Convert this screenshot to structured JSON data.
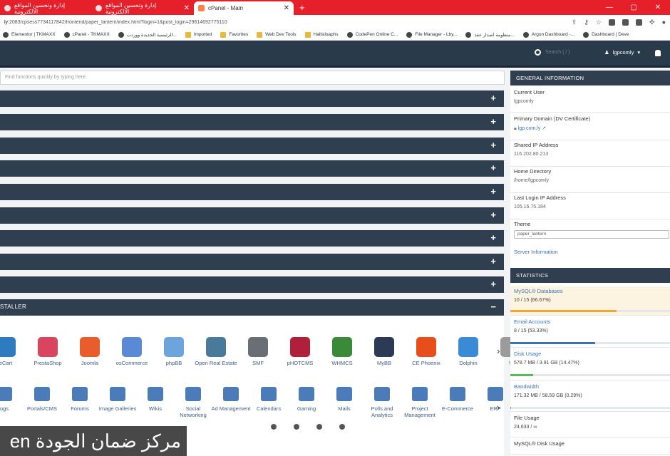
{
  "browser": {
    "tabs": [
      {
        "title": "إدارة وتحسين المواقع الالكترونية"
      },
      {
        "title": "إدارة وتحسين المواقع الالكترونية"
      },
      {
        "title": "cPanel - Main"
      }
    ],
    "new_tab": "+",
    "url_prefix": "ly",
    "url_rest": ":2083/cpsess7734117842/frontend/paper_lantern/index.html?login=1&post_login=29614692775110",
    "bookmarks": [
      {
        "label": "Elementor | TKMAXX",
        "icon": "globe-icon"
      },
      {
        "label": "cPanel - TKMAXX",
        "icon": "cpanel-icon"
      },
      {
        "label": "الرئيسية الجديدة ووردب...",
        "icon": "wordpress-icon"
      },
      {
        "label": "Imported",
        "icon": "folder-icon"
      },
      {
        "label": "Favorites",
        "icon": "folder-icon"
      },
      {
        "label": "Web Dev Tools",
        "icon": "folder-icon"
      },
      {
        "label": "Hallsiloaphs",
        "icon": "folder-icon"
      },
      {
        "label": "CodePen Online C...",
        "icon": "codepen-icon"
      },
      {
        "label": "File Manager - Lby...",
        "icon": "file-icon"
      },
      {
        "label": "منظومة اصدار عقد...",
        "icon": "globe-icon"
      },
      {
        "label": "Argon Dashboard -...",
        "icon": "globe-icon"
      },
      {
        "label": "Dashboard | Deve",
        "icon": "globe-icon"
      }
    ]
  },
  "header": {
    "search_placeholder": "Search ( / )",
    "username": "lgpcomly"
  },
  "filter": {
    "placeholder": "Find functions quickly by typing here."
  },
  "categories": [
    {
      "label": ""
    },
    {
      "label": ""
    },
    {
      "label": ""
    },
    {
      "label": ""
    },
    {
      "label": ""
    },
    {
      "label": ""
    },
    {
      "label": ""
    },
    {
      "label": ""
    },
    {
      "label": ""
    },
    {
      "label": ""
    },
    {
      "label": "STALLER",
      "expanded": true
    }
  ],
  "category_toggle": {
    "collapsed": "+",
    "expanded": "−"
  },
  "apps": [
    {
      "label": "eCart",
      "color": "#2e7bc0"
    },
    {
      "label": "PrestaShop",
      "color": "#d9455f"
    },
    {
      "label": "Joomla",
      "color": "#e95d2d"
    },
    {
      "label": "osCommerce",
      "color": "#5a8ad6"
    },
    {
      "label": "phpBB",
      "color": "#6ea4de"
    },
    {
      "label": "Open Real Estate",
      "color": "#4a7a9a"
    },
    {
      "label": "SMF",
      "color": "#6a6f75"
    },
    {
      "label": "pHOTCMS",
      "color": "#b0203a"
    },
    {
      "label": "WHMCS",
      "color": "#3a8a3a"
    },
    {
      "label": "MyBB",
      "color": "#2c3a56"
    },
    {
      "label": "CE Phoenix",
      "color": "#e84d1c"
    },
    {
      "label": "Dolphin",
      "color": "#3a8ad8"
    },
    {
      "label": "Y",
      "color": "#9b9b9b"
    }
  ],
  "app_categories": [
    {
      "label": "ogs"
    },
    {
      "label": "Portals/CMS"
    },
    {
      "label": "Forums"
    },
    {
      "label": "Image Galleries"
    },
    {
      "label": "Wikis"
    },
    {
      "label": "Social Networking"
    },
    {
      "label": "Ad Management"
    },
    {
      "label": "Calendars"
    },
    {
      "label": "Gaming"
    },
    {
      "label": "Mails"
    },
    {
      "label": "Polls and Analytics"
    },
    {
      "label": "Project Management"
    },
    {
      "label": "E-Commerce"
    },
    {
      "label": "ERP"
    }
  ],
  "carousel_next": "›",
  "overlay_text": "مركز ضمان الجودة en",
  "general_info": {
    "heading": "GENERAL INFORMATION",
    "current_user_label": "Current User",
    "current_user": "lgpcomly",
    "primary_domain_label": "Primary Domain (DV Certificate)",
    "primary_domain": "lgp.com.ly",
    "shared_ip_label": "Shared IP Address",
    "shared_ip": "116.202.80.213",
    "home_dir_label": "Home Directory",
    "home_dir": "/home/lgpcomly",
    "last_login_label": "Last Login IP Address",
    "last_login": "105.16.75.184",
    "theme_label": "Theme",
    "theme": "paper_lantern",
    "server_info": "Server Information"
  },
  "statistics": {
    "heading": "STATISTICS",
    "items": [
      {
        "label": "MySQL® Databases",
        "value": "10 / 15   (66.67%)",
        "percent": 66.67,
        "color": "#f0a63a"
      },
      {
        "label": "Email Accounts",
        "value": "8 / 15   (53.33%)",
        "percent": 53.33,
        "color": "#3a74b4"
      },
      {
        "label": "Disk Usage",
        "value": "578.7 MB / 3.91 GB   (14.47%)",
        "percent": 14.47,
        "color": "#5cb85c"
      },
      {
        "label": "Bandwidth",
        "value": "171.32 MB / 58.59 GB   (0.29%)",
        "percent": 0.29,
        "color": "#5cb85c"
      },
      {
        "label": "File Usage",
        "value": "24,633 / ∞"
      },
      {
        "label": "MySQL® Disk Usage",
        "value": ""
      }
    ]
  },
  "colors": {
    "accent": "#e5202b",
    "header_bg": "#293a4a",
    "category_bg": "#2f3f50",
    "link": "#3a74b4"
  }
}
